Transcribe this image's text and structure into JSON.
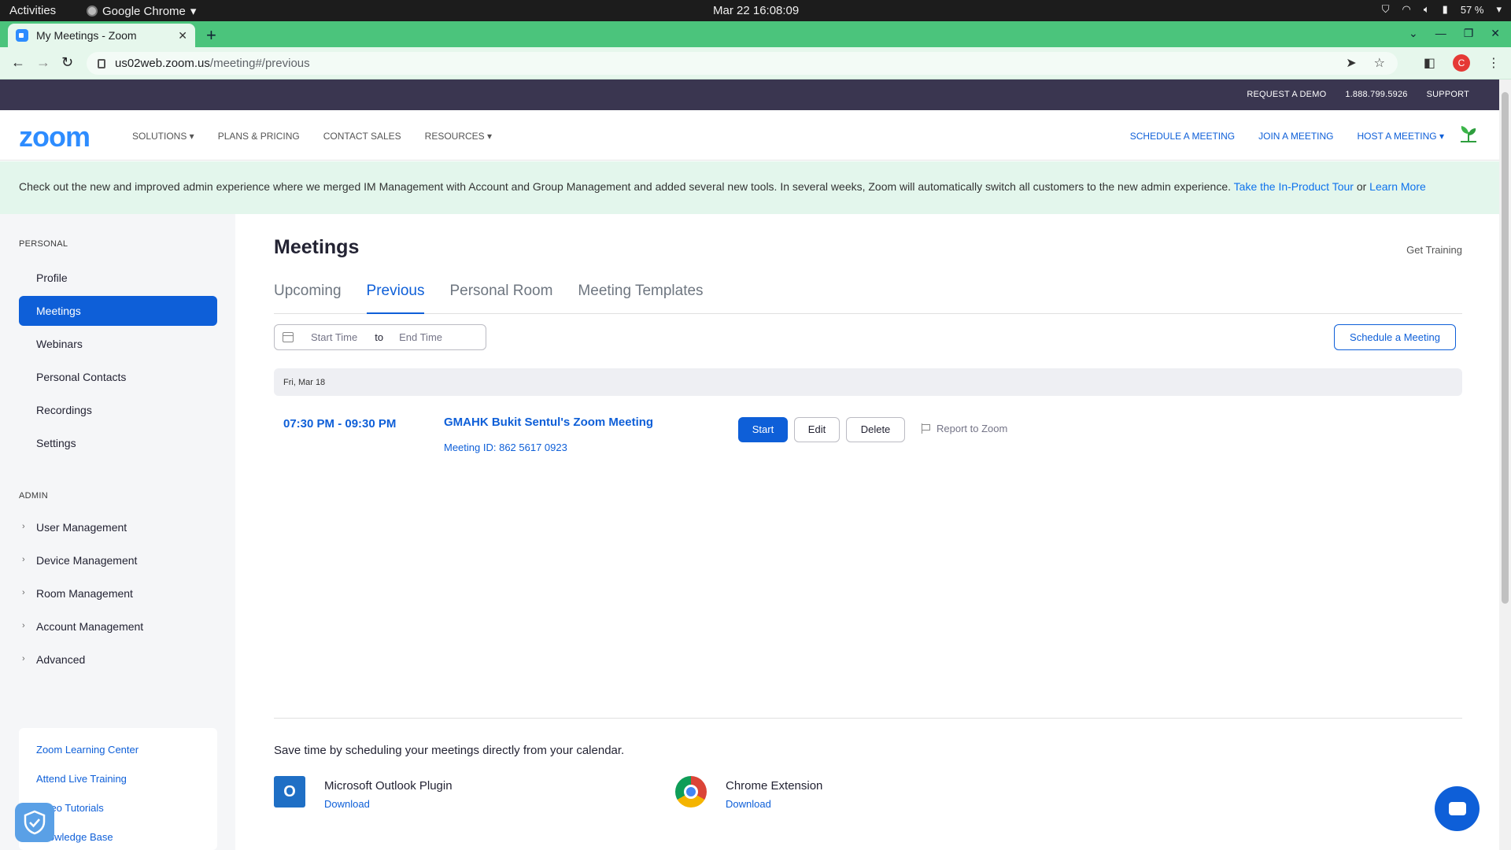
{
  "os": {
    "activities": "Activities",
    "app_name": "Google Chrome",
    "clock": "Mar 22  16:08:09",
    "battery": "57 %"
  },
  "browser": {
    "tab_title": "My Meetings - Zoom",
    "tab_close": "✕",
    "new_tab": "+",
    "url_host": "us02web.zoom.us",
    "url_path": "/meeting#/previous",
    "profile_initial": "C"
  },
  "zoom_top": {
    "request_demo": "REQUEST A DEMO",
    "phone": "1.888.799.5926",
    "support": "SUPPORT"
  },
  "nav": {
    "logo": "zoom",
    "left": [
      "SOLUTIONS ▾",
      "PLANS & PRICING",
      "CONTACT SALES",
      "RESOURCES ▾"
    ],
    "right": [
      "SCHEDULE A MEETING",
      "JOIN A MEETING",
      "HOST A MEETING ▾"
    ]
  },
  "banner": {
    "text": "Check out the new and improved admin experience where we merged IM Management with Account and Group Management and added several new tools. In several weeks, Zoom will automatically switch all customers to the new admin experience. ",
    "tour_link": "Take the In-Product Tour",
    "or": " or ",
    "learn_link": "Learn More"
  },
  "sidebar": {
    "personal_label": "PERSONAL",
    "personal_items": [
      "Profile",
      "Meetings",
      "Webinars",
      "Personal Contacts",
      "Recordings",
      "Settings"
    ],
    "active_index": 1,
    "admin_label": "ADMIN",
    "admin_items": [
      "User Management",
      "Device Management",
      "Room Management",
      "Account Management",
      "Advanced"
    ],
    "help_links": [
      "Zoom Learning Center",
      "Attend Live Training",
      "Video Tutorials",
      "Knowledge Base"
    ]
  },
  "main": {
    "title": "Meetings",
    "get_training": "Get Training",
    "tabs": [
      "Upcoming",
      "Previous",
      "Personal Room",
      "Meeting Templates"
    ],
    "active_tab": 1,
    "date_from_placeholder": "Start Time",
    "date_to": "to",
    "date_to_placeholder": "End Time",
    "schedule_button": "Schedule a Meeting",
    "day_header": "Fri, Mar 18",
    "meeting": {
      "time": "07:30 PM - 09:30 PM",
      "title": "GMAHK Bukit Sentul's Zoom Meeting",
      "meeting_id": "Meeting ID: 862 5617 0923",
      "start": "Start",
      "edit": "Edit",
      "delete": "Delete",
      "report": "Report to Zoom"
    },
    "calendar_prompt": "Save time by scheduling your meetings directly from your calendar.",
    "plugins": [
      {
        "name": "Microsoft Outlook Plugin",
        "action": "Download",
        "icon": "outlook-icon"
      },
      {
        "name": "Chrome Extension",
        "action": "Download",
        "icon": "chrome-icon"
      }
    ]
  },
  "colors": {
    "accent": "#0e5fd8",
    "tab_strip": "#4bc47c",
    "banner_bg": "#e3f6ec",
    "zoom_topbar": "#3a3650"
  }
}
